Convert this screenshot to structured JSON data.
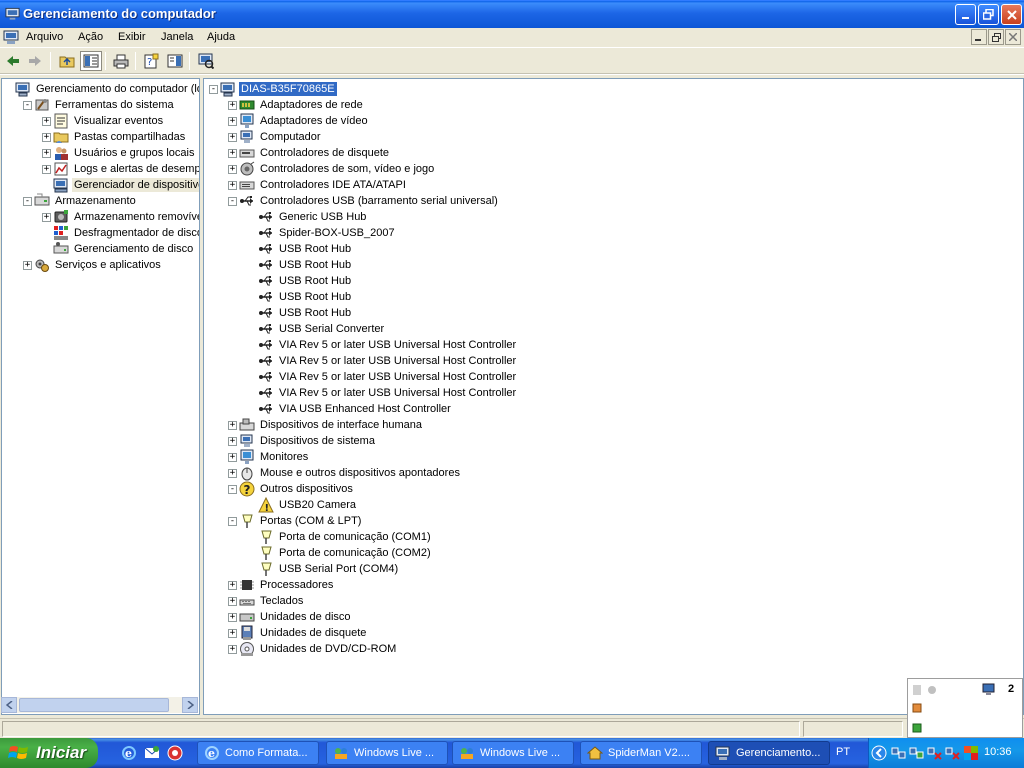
{
  "window": {
    "title": "Gerenciamento do computador"
  },
  "menu": {
    "items": [
      "Arquivo",
      "Ação",
      "Exibir",
      "Janela",
      "Ajuda"
    ]
  },
  "left_tree": [
    {
      "label": "Gerenciamento do computador (loca",
      "level": 0,
      "exp": "none",
      "icon": "computer"
    },
    {
      "label": "Ferramentas do sistema",
      "level": 1,
      "exp": "-",
      "icon": "tools"
    },
    {
      "label": "Visualizar eventos",
      "level": 2,
      "exp": "+",
      "icon": "event-viewer"
    },
    {
      "label": "Pastas compartilhadas",
      "level": 2,
      "exp": "+",
      "icon": "shared-folder"
    },
    {
      "label": "Usuários e grupos locais",
      "level": 2,
      "exp": "+",
      "icon": "users"
    },
    {
      "label": "Logs e alertas de desempen",
      "level": 2,
      "exp": "+",
      "icon": "perf-logs"
    },
    {
      "label": "Gerenciador de dispositivos",
      "level": 2,
      "exp": "none",
      "icon": "device-manager",
      "selected": true
    },
    {
      "label": "Armazenamento",
      "level": 1,
      "exp": "-",
      "icon": "storage"
    },
    {
      "label": "Armazenamento removível",
      "level": 2,
      "exp": "+",
      "icon": "removable"
    },
    {
      "label": "Desfragmentador de disco",
      "level": 2,
      "exp": "none",
      "icon": "defrag"
    },
    {
      "label": "Gerenciamento de disco",
      "level": 2,
      "exp": "none",
      "icon": "disk-mgmt"
    },
    {
      "label": "Serviços e aplicativos",
      "level": 1,
      "exp": "+",
      "icon": "services"
    }
  ],
  "right_tree": [
    {
      "label": "DIAS-B35F70865E",
      "level": 0,
      "exp": "-",
      "icon": "computer",
      "selected": true
    },
    {
      "label": "Adaptadores de rede",
      "level": 1,
      "exp": "+",
      "icon": "network"
    },
    {
      "label": "Adaptadores de vídeo",
      "level": 1,
      "exp": "+",
      "icon": "display"
    },
    {
      "label": "Computador",
      "level": 1,
      "exp": "+",
      "icon": "computer-small"
    },
    {
      "label": "Controladores de disquete",
      "level": 1,
      "exp": "+",
      "icon": "floppy-ctrl"
    },
    {
      "label": "Controladores de som, vídeo e jogo",
      "level": 1,
      "exp": "+",
      "icon": "sound"
    },
    {
      "label": "Controladores IDE ATA/ATAPI",
      "level": 1,
      "exp": "+",
      "icon": "ide"
    },
    {
      "label": "Controladores USB (barramento serial universal)",
      "level": 1,
      "exp": "-",
      "icon": "usb"
    },
    {
      "label": "Generic USB Hub",
      "level": 2,
      "exp": "none",
      "icon": "usb"
    },
    {
      "label": "Spider-BOX-USB_2007",
      "level": 2,
      "exp": "none",
      "icon": "usb"
    },
    {
      "label": "USB Root Hub",
      "level": 2,
      "exp": "none",
      "icon": "usb"
    },
    {
      "label": "USB Root Hub",
      "level": 2,
      "exp": "none",
      "icon": "usb"
    },
    {
      "label": "USB Root Hub",
      "level": 2,
      "exp": "none",
      "icon": "usb"
    },
    {
      "label": "USB Root Hub",
      "level": 2,
      "exp": "none",
      "icon": "usb"
    },
    {
      "label": "USB Root Hub",
      "level": 2,
      "exp": "none",
      "icon": "usb"
    },
    {
      "label": "USB Serial Converter",
      "level": 2,
      "exp": "none",
      "icon": "usb"
    },
    {
      "label": "VIA Rev 5 or later USB Universal Host Controller",
      "level": 2,
      "exp": "none",
      "icon": "usb"
    },
    {
      "label": "VIA Rev 5 or later USB Universal Host Controller",
      "level": 2,
      "exp": "none",
      "icon": "usb"
    },
    {
      "label": "VIA Rev 5 or later USB Universal Host Controller",
      "level": 2,
      "exp": "none",
      "icon": "usb"
    },
    {
      "label": "VIA Rev 5 or later USB Universal Host Controller",
      "level": 2,
      "exp": "none",
      "icon": "usb"
    },
    {
      "label": "VIA USB Enhanced Host Controller",
      "level": 2,
      "exp": "none",
      "icon": "usb"
    },
    {
      "label": "Dispositivos de interface humana",
      "level": 1,
      "exp": "+",
      "icon": "hid"
    },
    {
      "label": "Dispositivos de sistema",
      "level": 1,
      "exp": "+",
      "icon": "computer-small"
    },
    {
      "label": "Monitores",
      "level": 1,
      "exp": "+",
      "icon": "display"
    },
    {
      "label": "Mouse e outros dispositivos apontadores",
      "level": 1,
      "exp": "+",
      "icon": "mouse"
    },
    {
      "label": "Outros dispositivos",
      "level": 1,
      "exp": "-",
      "icon": "unknown"
    },
    {
      "label": "USB20 Camera",
      "level": 2,
      "exp": "none",
      "icon": "warning"
    },
    {
      "label": "Portas (COM & LPT)",
      "level": 1,
      "exp": "-",
      "icon": "port"
    },
    {
      "label": "Porta de comunicação (COM1)",
      "level": 2,
      "exp": "none",
      "icon": "port"
    },
    {
      "label": "Porta de comunicação (COM2)",
      "level": 2,
      "exp": "none",
      "icon": "port"
    },
    {
      "label": "USB Serial Port (COM4)",
      "level": 2,
      "exp": "none",
      "icon": "port"
    },
    {
      "label": "Processadores",
      "level": 1,
      "exp": "+",
      "icon": "cpu"
    },
    {
      "label": "Teclados",
      "level": 1,
      "exp": "+",
      "icon": "keyboard"
    },
    {
      "label": "Unidades de disco",
      "level": 1,
      "exp": "+",
      "icon": "disk"
    },
    {
      "label": "Unidades de disquete",
      "level": 1,
      "exp": "+",
      "icon": "floppy"
    },
    {
      "label": "Unidades de DVD/CD-ROM",
      "level": 1,
      "exp": "+",
      "icon": "cdrom"
    }
  ],
  "taskbar": {
    "start_label": "Iniciar",
    "tasks": [
      {
        "label": "Como Formata...",
        "icon": "ie-icon",
        "active": false
      },
      {
        "label": "Windows Live ...",
        "icon": "wlm-icon",
        "active": false
      },
      {
        "label": "Windows Live ...",
        "icon": "wlm-icon",
        "active": false
      },
      {
        "label": "SpiderMan V2....",
        "icon": "home-icon",
        "active": false
      },
      {
        "label": "Gerenciamento...",
        "icon": "computer-mgmt-icon",
        "active": true
      }
    ],
    "language": "PT",
    "clock": "10:36"
  },
  "tray_popup": {
    "badge": "2"
  },
  "colors": {
    "selection": "#316ac5",
    "titlebar": "#0c56d6",
    "taskbar": "#2663e0",
    "start": "#49b047"
  }
}
